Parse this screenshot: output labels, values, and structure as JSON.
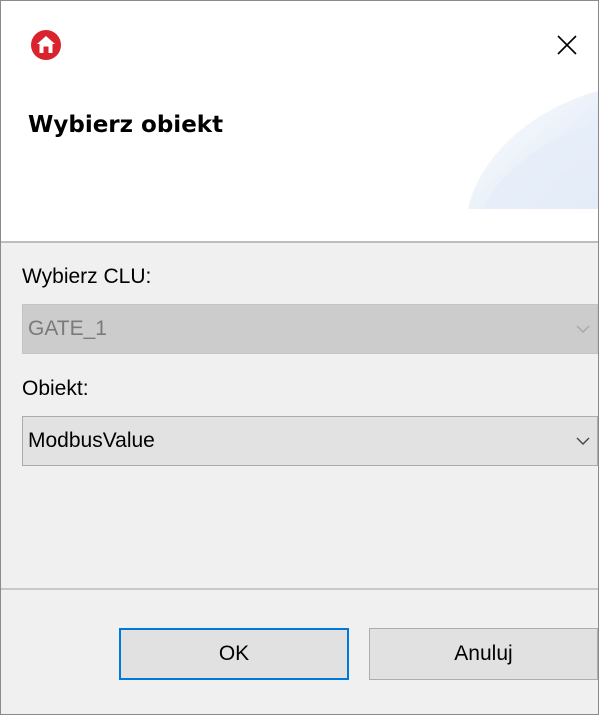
{
  "window": {
    "app_icon": "home-icon",
    "close_icon": "close-icon"
  },
  "header": {
    "title": "Wybierz obiekt"
  },
  "form": {
    "clu_label": "Wybierz CLU:",
    "clu_value": "GATE_1",
    "clu_enabled": false,
    "object_label": "Obiekt:",
    "object_value": "ModbusValue",
    "object_enabled": true
  },
  "buttons": {
    "ok_label": "OK",
    "cancel_label": "Anuluj"
  },
  "colors": {
    "app_icon_bg": "#d9232d",
    "default_button_border": "#0078d7",
    "disabled_combo_bg": "#cccccc",
    "disabled_text": "#7a7a7a"
  }
}
